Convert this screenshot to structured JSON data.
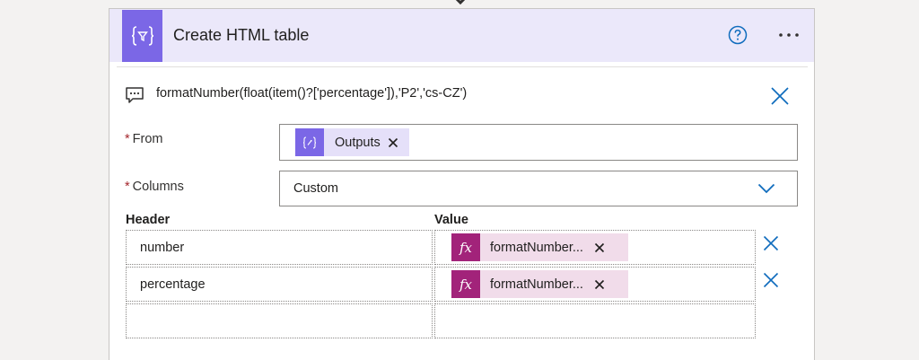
{
  "colors": {
    "accent": "#7b67e6",
    "header_bg": "#ebe8fa",
    "expression_token": "#a2237a",
    "expression_token_bg": "#f1dcea",
    "link_blue": "#0f6cbd",
    "required": "#a4262c"
  },
  "action": {
    "title": "Create HTML table",
    "icon": "html-table-action-icon",
    "help_icon": "help-circle-icon",
    "more_icon": "more-horizontal-icon"
  },
  "comment": {
    "icon": "comment-icon",
    "text": "formatNumber(float(item()?['percentage']),'P2','cs-CZ')",
    "close_icon": "close-icon"
  },
  "fields": {
    "from": {
      "label": "From",
      "required_mark": "*",
      "token": {
        "label": "Outputs",
        "icon": "compose-token-icon",
        "remove_icon": "close-icon"
      }
    },
    "columns": {
      "label": "Columns",
      "required_mark": "*",
      "value": "Custom",
      "icon": "chevron-down-icon"
    }
  },
  "table": {
    "headers": {
      "header": "Header",
      "value": "Value"
    },
    "rows": [
      {
        "header": "number",
        "value_token": "formatNumber...",
        "value_icon": "fx"
      },
      {
        "header": "percentage",
        "value_token": "formatNumber...",
        "value_icon": "fx"
      },
      {
        "header": "",
        "value_token": ""
      }
    ],
    "row_delete_icon": "close-icon"
  }
}
